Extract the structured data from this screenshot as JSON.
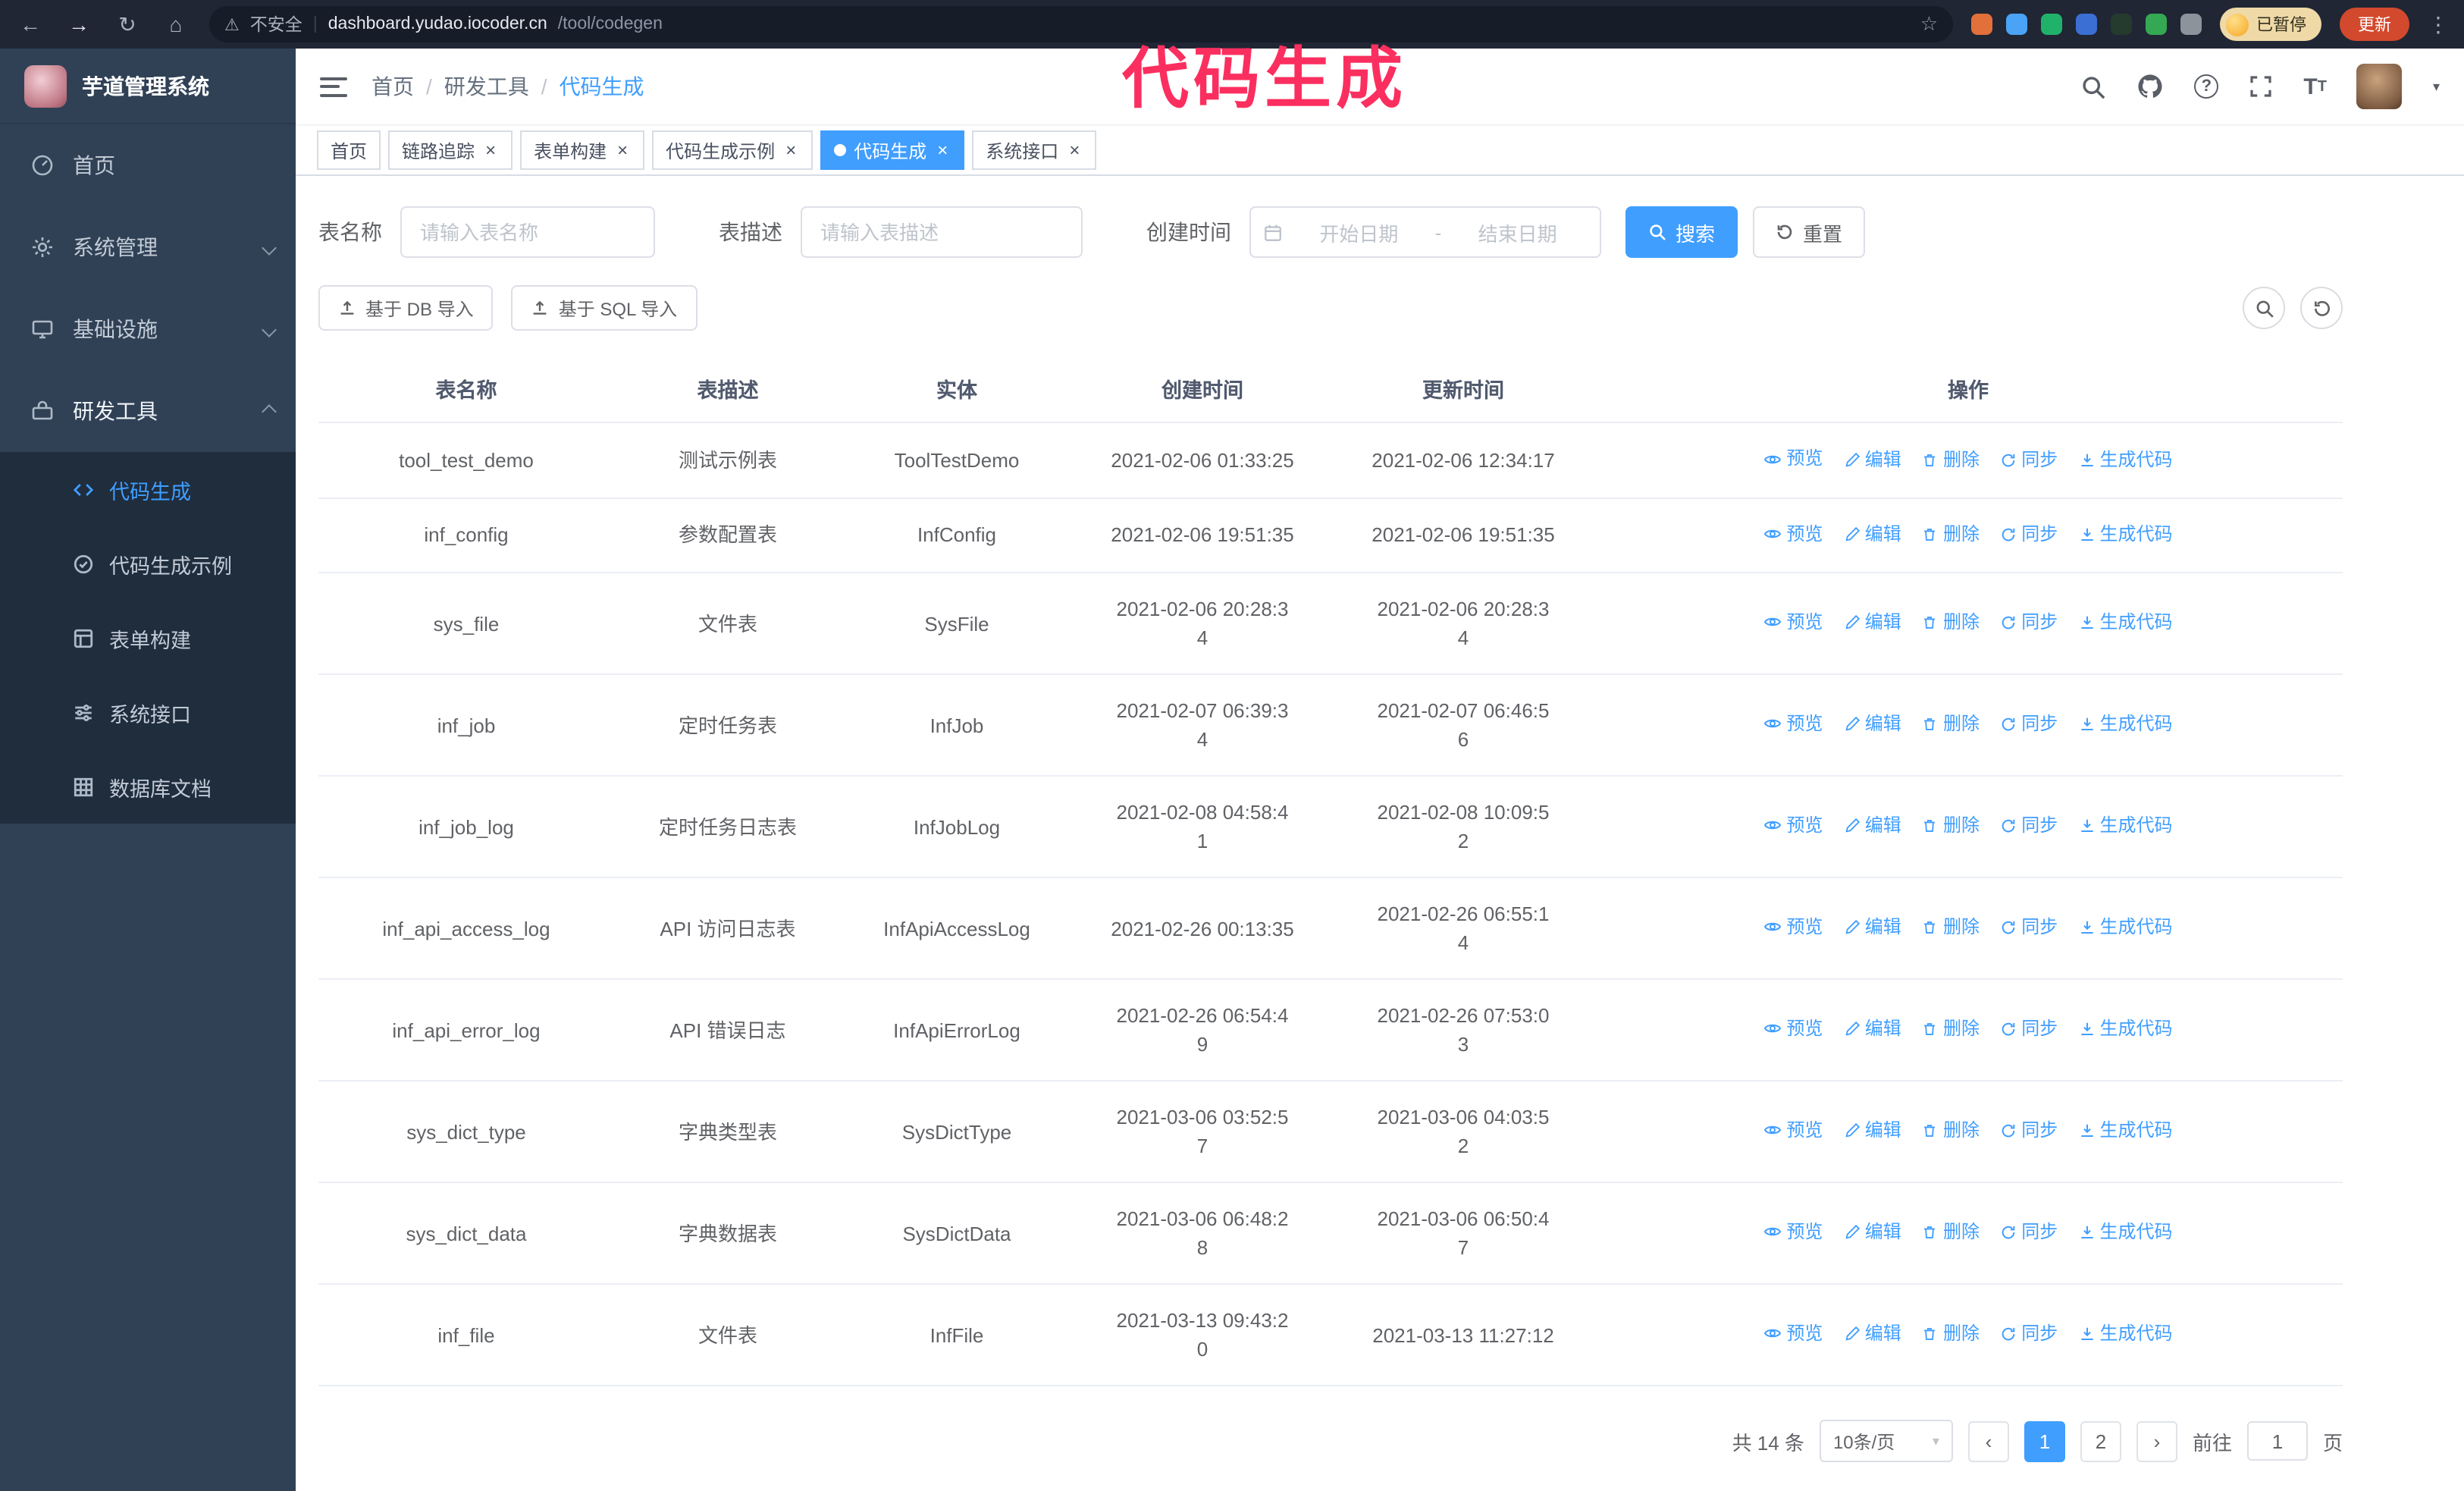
{
  "colors": {
    "accent": "#409eff",
    "annotation": "#fb2f5f",
    "sidebar_bg": "#304156",
    "submenu_bg": "#1f2d3d",
    "chrome_bg": "#202634",
    "update_btn": "#d2492e"
  },
  "annotation": {
    "text": "代码生成"
  },
  "browser": {
    "security_label": "不安全",
    "url_host": "dashboard.yudao.iocoder.cn",
    "url_path": "/tool/codegen",
    "profile_badge": "已暂停",
    "update_button": "更新",
    "extension_colors": [
      "#e2703a",
      "#4aa3f5",
      "#21b26a",
      "#3b6fd4",
      "#243b2d",
      "#34a853",
      "#8d939b"
    ]
  },
  "icons": {
    "back": "←",
    "forward": "→",
    "reload": "↻",
    "home": "⌂",
    "warning": "⚠",
    "divider": "|",
    "star": "☆",
    "kebab": "⋮",
    "close": "×",
    "caret_down": "▾",
    "question": "?"
  },
  "sidebar": {
    "app_title": "芋道管理系统",
    "items": [
      {
        "label": "首页"
      },
      {
        "label": "系统管理"
      },
      {
        "label": "基础设施"
      },
      {
        "label": "研发工具"
      }
    ],
    "submenu": [
      {
        "label": "代码生成",
        "active": true
      },
      {
        "label": "代码生成示例"
      },
      {
        "label": "表单构建"
      },
      {
        "label": "系统接口"
      },
      {
        "label": "数据库文档"
      }
    ]
  },
  "header": {
    "breadcrumb": [
      "首页",
      "研发工具",
      "代码生成"
    ],
    "separator": "/"
  },
  "tabs": [
    {
      "label": "首页"
    },
    {
      "label": "链路追踪"
    },
    {
      "label": "表单构建"
    },
    {
      "label": "代码生成示例"
    },
    {
      "label": "代码生成"
    },
    {
      "label": "系统接口"
    }
  ],
  "filter": {
    "table_name_label": "表名称",
    "table_name_placeholder": "请输入表名称",
    "table_desc_label": "表描述",
    "table_desc_placeholder": "请输入表描述",
    "create_time_label": "创建时间",
    "date_start_placeholder": "开始日期",
    "date_separator": "-",
    "date_end_placeholder": "结束日期",
    "search_button": "搜索",
    "reset_button": "重置"
  },
  "toolbar": {
    "import_db": "基于 DB 导入",
    "import_sql": "基于 SQL 导入"
  },
  "table": {
    "columns": [
      "表名称",
      "表描述",
      "实体",
      "创建时间",
      "更新时间",
      "操作"
    ],
    "actions": [
      "预览",
      "编辑",
      "删除",
      "同步",
      "生成代码"
    ],
    "rows": [
      {
        "name": "tool_test_demo",
        "desc": "测试示例表",
        "entity": "ToolTestDemo",
        "created": "2021-02-06 01:33:25",
        "updated": "2021-02-06 12:34:17"
      },
      {
        "name": "inf_config",
        "desc": "参数配置表",
        "entity": "InfConfig",
        "created": "2021-02-06 19:51:35",
        "updated": "2021-02-06 19:51:35"
      },
      {
        "name": "sys_file",
        "desc": "文件表",
        "entity": "SysFile",
        "created": "2021-02-06 20:28:3\n4",
        "updated": "2021-02-06 20:28:3\n4"
      },
      {
        "name": "inf_job",
        "desc": "定时任务表",
        "entity": "InfJob",
        "created": "2021-02-07 06:39:3\n4",
        "updated": "2021-02-07 06:46:5\n6"
      },
      {
        "name": "inf_job_log",
        "desc": "定时任务日志表",
        "entity": "InfJobLog",
        "created": "2021-02-08 04:58:4\n1",
        "updated": "2021-02-08 10:09:5\n2"
      },
      {
        "name": "inf_api_access_log",
        "desc": "API 访问日志表",
        "entity": "InfApiAccessLog",
        "created": "2021-02-26 00:13:35",
        "updated": "2021-02-26 06:55:1\n4"
      },
      {
        "name": "inf_api_error_log",
        "desc": "API 错误日志",
        "entity": "InfApiErrorLog",
        "created": "2021-02-26 06:54:4\n9",
        "updated": "2021-02-26 07:53:0\n3"
      },
      {
        "name": "sys_dict_type",
        "desc": "字典类型表",
        "entity": "SysDictType",
        "created": "2021-03-06 03:52:5\n7",
        "updated": "2021-03-06 04:03:5\n2"
      },
      {
        "name": "sys_dict_data",
        "desc": "字典数据表",
        "entity": "SysDictData",
        "created": "2021-03-06 06:48:2\n8",
        "updated": "2021-03-06 06:50:4\n7"
      },
      {
        "name": "inf_file",
        "desc": "文件表",
        "entity": "InfFile",
        "created": "2021-03-13 09:43:2\n0",
        "updated": "2021-03-13 11:27:12"
      }
    ]
  },
  "pagination": {
    "total": "共 14 条",
    "page_size": "10条/页",
    "prev": "‹",
    "next": "›",
    "pages": [
      "1",
      "2"
    ],
    "goto_label": "前往",
    "goto_value": "1",
    "goto_unit": "页"
  }
}
